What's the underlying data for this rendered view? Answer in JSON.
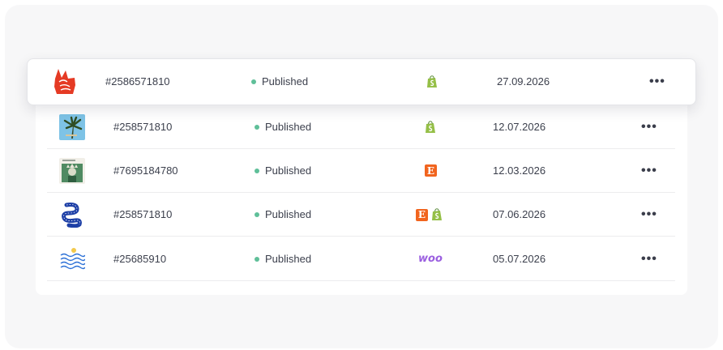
{
  "colors": {
    "status_published": "#5fbf99",
    "etsy": "#f1641e",
    "shopify": "#95bf47",
    "woo": "#9b5fe0"
  },
  "orders": [
    {
      "id": "#2586571810",
      "status": "Published",
      "channels": [
        "shopify-icon"
      ],
      "date": "27.09.2026",
      "more": "•••",
      "thumb": "peace-hand-thumbnail"
    },
    {
      "id": "#258571810",
      "status": "Published",
      "channels": [
        "shopify-icon"
      ],
      "date": "12.07.2026",
      "more": "•••",
      "thumb": "palm-tree-thumbnail"
    },
    {
      "id": "#7695184780",
      "status": "Published",
      "channels": [
        "etsy-icon"
      ],
      "date": "12.03.2026",
      "more": "•••",
      "thumb": "statue-liberty-thumbnail"
    },
    {
      "id": "#258571810",
      "status": "Published",
      "channels": [
        "etsy-icon",
        "shopify-icon"
      ],
      "date": "07.06.2026",
      "more": "•••",
      "thumb": "snake-poster-thumbnail"
    },
    {
      "id": "#25685910",
      "status": "Published",
      "channels": [
        "woo-icon"
      ],
      "date": "05.07.2026",
      "more": "•••",
      "thumb": "waves-poster-thumbnail"
    }
  ],
  "woo_label": "woo",
  "etsy_label": "E"
}
